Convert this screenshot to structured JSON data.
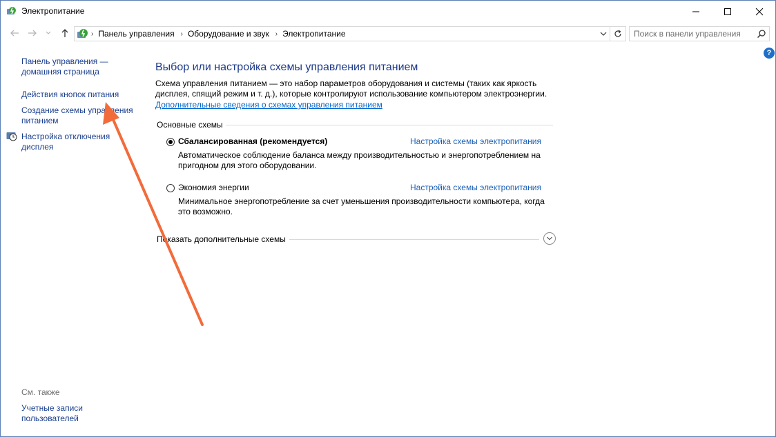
{
  "window": {
    "title": "Электропитание",
    "controls": {
      "minimize": "minimize",
      "maximize": "maximize",
      "close": "close"
    }
  },
  "address": {
    "crumbs": [
      "Панель управления",
      "Оборудование и звук",
      "Электропитание"
    ]
  },
  "search": {
    "placeholder": "Поиск в панели управления"
  },
  "sidebar": {
    "links": [
      "Панель управления — домашняя страница",
      "Действия кнопок питания",
      "Создание схемы управления питанием",
      "Настройка отключения дисплея"
    ],
    "see_also_label": "См. также",
    "see_also_links": [
      "Учетные записи пользователей"
    ]
  },
  "main": {
    "title": "Выбор или настройка схемы управления питанием",
    "description": "Схема управления питанием — это набор параметров оборудования и системы (таких как яркость дисплея, спящий режим и т. д.), которые контролируют использование компьютером электроэнергии.",
    "more_info_link": "Дополнительные сведения о схемах управления питанием",
    "section_label": "Основные схемы",
    "plans": [
      {
        "name": "Сбалансированная (рекомендуется)",
        "selected": true,
        "link": "Настройка схемы электропитания",
        "description": "Автоматическое соблюдение баланса между производительностью и энергопотреблением на пригодном для этого оборудовании."
      },
      {
        "name": "Экономия энергии",
        "selected": false,
        "link": "Настройка схемы электропитания",
        "description": "Минимальное энергопотребление за счет уменьшения производительности компьютера, когда это возможно."
      }
    ],
    "show_more_label": "Показать дополнительные схемы"
  },
  "colors": {
    "accent_link": "#1a5fb4",
    "title_blue": "#1e3b8a",
    "annotation_arrow": "#f26b3a"
  }
}
